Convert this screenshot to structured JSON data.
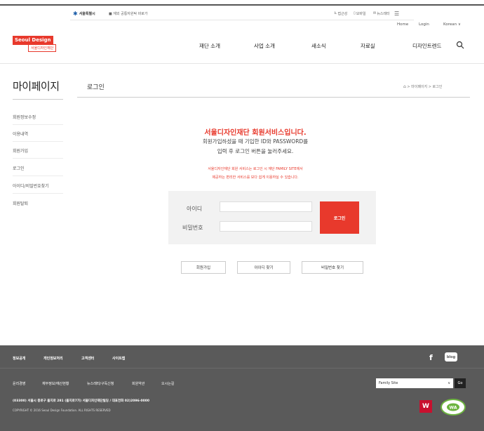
{
  "utility_bar": {
    "seoul_logo": "서울특별시",
    "sub_link": "■ 재외 공통자원탁 바로가",
    "icons": [
      {
        "label": "접근성"
      },
      {
        "label": "모바일"
      },
      {
        "label": "뉴스레터"
      },
      {
        "label": "메뉴"
      }
    ]
  },
  "brand": {
    "line1": "Seoul  Design",
    "line2": "서울디자인재단"
  },
  "header_links": {
    "home": "Home",
    "login": "Login",
    "lang": "Korean"
  },
  "gnb": [
    "재단 소개",
    "사업 소개",
    "새소식",
    "자료실",
    "디자인트렌드"
  ],
  "sidebar": {
    "title": "마이페이지",
    "items": [
      "회원정보수정",
      "이용내역",
      "회원가입",
      "로그인",
      "아이디/비밀번호찾기",
      "회원탈퇴"
    ]
  },
  "page": {
    "title": "로그인",
    "breadcrumb": "> 마이페이지 > 로그인"
  },
  "intro": {
    "headline": "서울디자인재단 회원서비스입니다.",
    "sub1": "회원가입하셨을 때 기입한 ID와 PASSWORD를",
    "sub2": "입력 후 로그인 버튼을 눌러주세요.",
    "note1": "서울디자인재단 회원 서비스는 로그인 시 재단 FAMILY SITE에서",
    "note2": "제공하는 편리한 서비스를 보다 쉽게 이용하실 수 있습니다."
  },
  "form": {
    "id_label": "아이디",
    "pw_label": "비밀번호",
    "login_button": "로그인"
  },
  "actions": [
    "회원가입",
    "아이디 찾기",
    "비밀번호 찾기"
  ],
  "footer": {
    "links1": [
      "정보공개",
      "개인정보처리",
      "고객센터",
      "사이트맵"
    ],
    "links2": [
      "윤리경영",
      "재무정보/예산현황",
      "뉴스레터/구독신청",
      "회원약관",
      "오시는길"
    ],
    "address": "(03300) 서울시 중로구 을지로 281 (을지로7가) 서울디자인재단빌딩 / 대표전화 02)2096-0000",
    "copyright": "COPYRIGHT © 2016 Seoul Design Foundation. ALL RIGHTS RESERVED",
    "family_site": "Family Site",
    "go": "Go",
    "blog": "blog"
  }
}
